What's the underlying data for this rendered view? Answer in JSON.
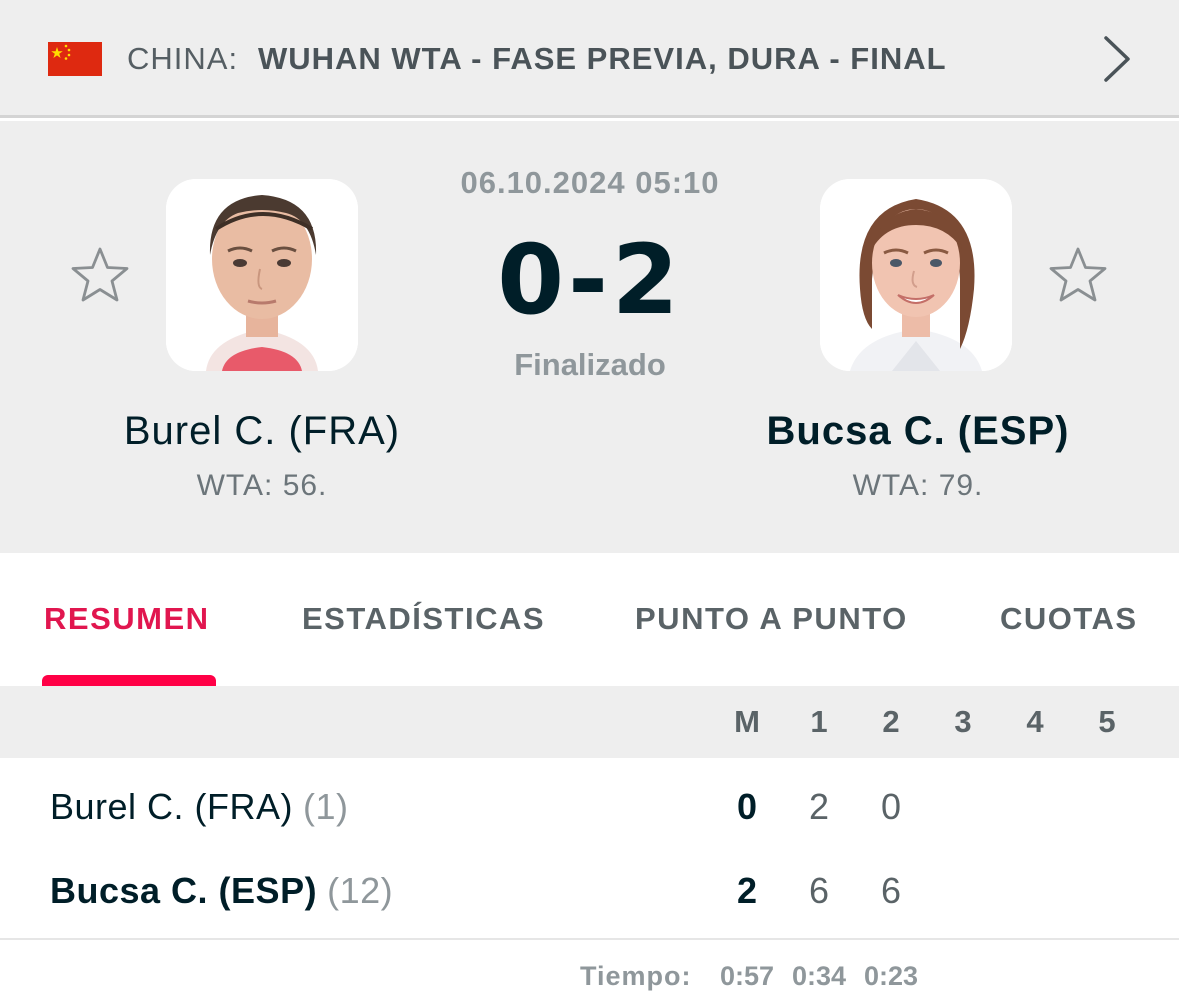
{
  "breadcrumb": {
    "country": "CHINA:",
    "tournament": "WUHAN WTA - FASE PREVIA, DURA - FINAL",
    "flag_icon": "china-flag-icon",
    "flag_color": "#de2910"
  },
  "match": {
    "datetime": "06.10.2024 05:10",
    "score": "0-2",
    "status": "Finalizado",
    "home": {
      "name": "Burel C. (FRA)",
      "rank": "WTA: 56."
    },
    "away": {
      "name": "Bucsa C. (ESP)",
      "rank": "WTA: 79."
    }
  },
  "tabs": [
    {
      "label": "RESUMEN",
      "active": true
    },
    {
      "label": "ESTADÍSTICAS",
      "active": false
    },
    {
      "label": "PUNTO A PUNTO",
      "active": false
    },
    {
      "label": "CUOTAS",
      "active": false
    }
  ],
  "score_table": {
    "columns": [
      "M",
      "1",
      "2",
      "3",
      "4",
      "5"
    ],
    "rows": [
      {
        "name": "Burel C. (FRA)",
        "seed": "(1)",
        "match": "0",
        "sets": [
          "2",
          "0"
        ]
      },
      {
        "name": "Bucsa C. (ESP)",
        "seed": "(12)",
        "match": "2",
        "sets": [
          "6",
          "6"
        ]
      }
    ],
    "time_label": "Tiempo:",
    "times": [
      "0:57",
      "0:34",
      "0:23"
    ]
  },
  "colors": {
    "accent": "#ff0046",
    "text_dark": "#001e28",
    "muted": "#8f979b"
  }
}
